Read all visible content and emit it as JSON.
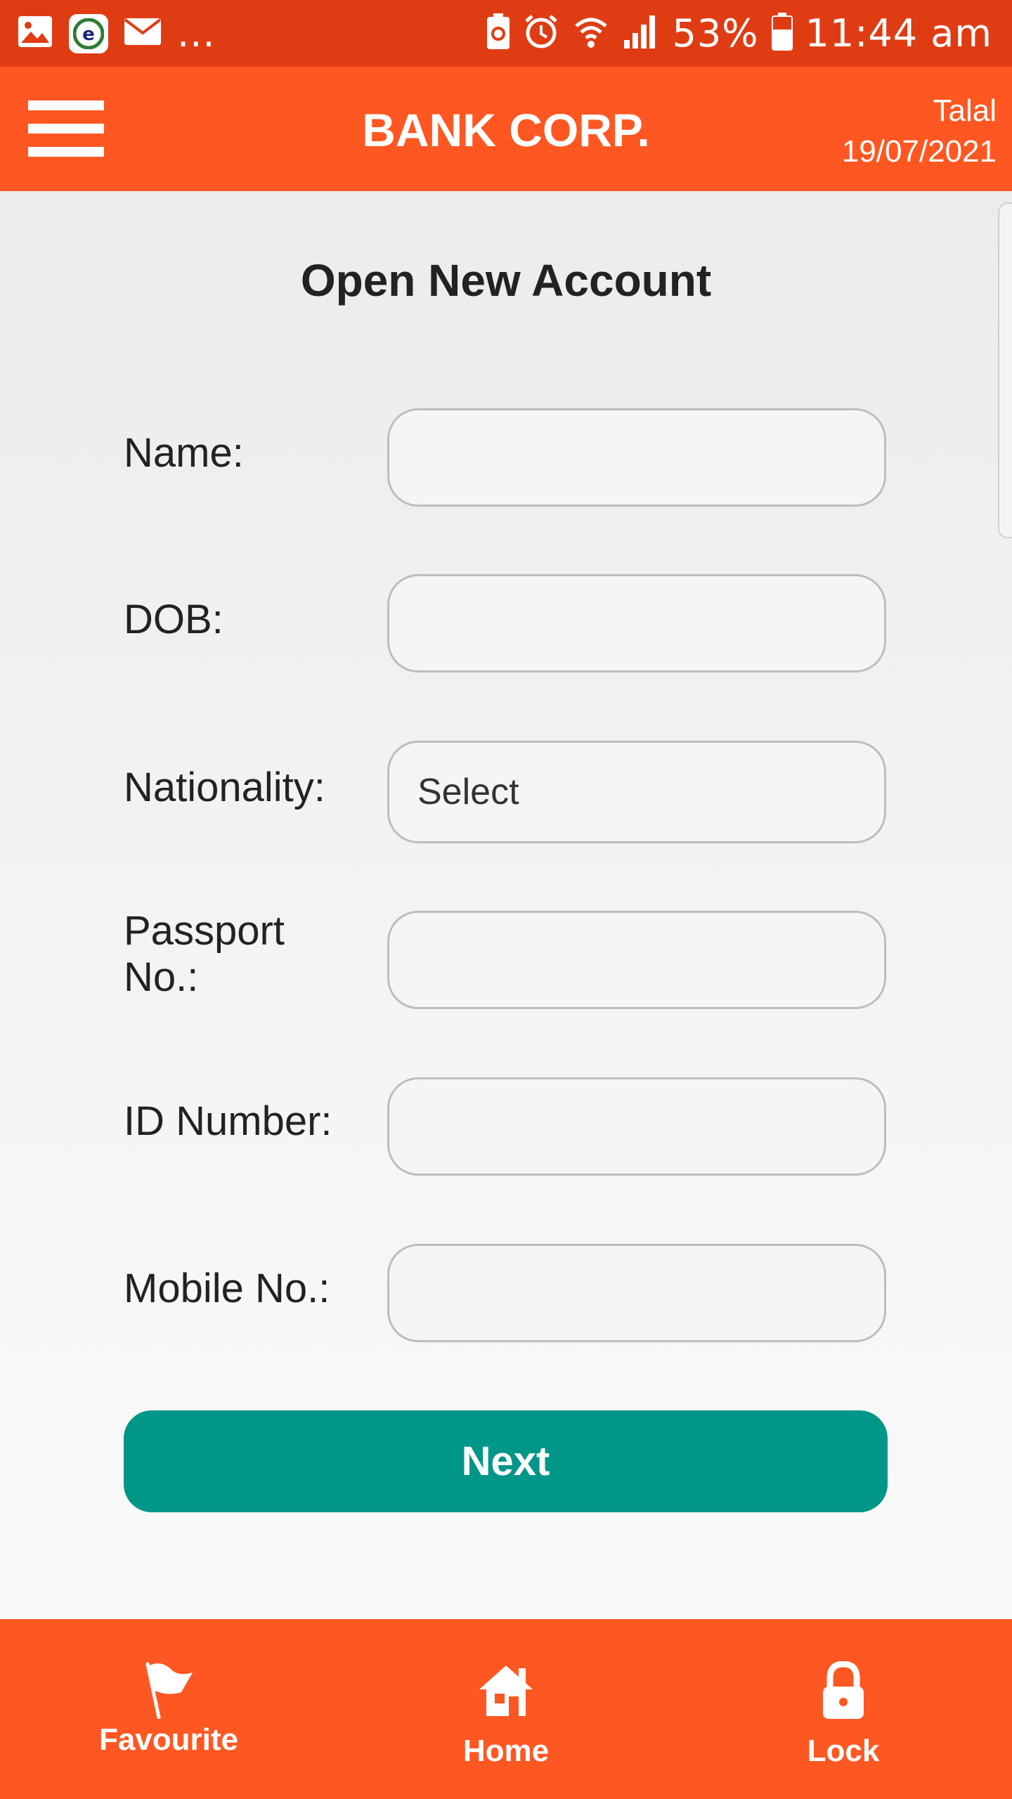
{
  "status_bar": {
    "more": "...",
    "battery": "53%",
    "time": "11:44 am",
    "icons": [
      "gallery-icon",
      "app-e-icon",
      "mail-icon",
      "battery-saver-icon",
      "alarm-icon",
      "wifi-icon",
      "signal-icon",
      "battery-icon"
    ]
  },
  "header": {
    "title": "BANK CORP.",
    "user": "Talal",
    "date": "19/07/2021",
    "menu_icon": "hamburger-menu-icon"
  },
  "form": {
    "title": "Open New Account",
    "fields": [
      {
        "label": "Name:",
        "value": ""
      },
      {
        "label": "DOB:",
        "value": ""
      },
      {
        "label": "Nationality:",
        "value": "Select"
      },
      {
        "label": "Passport No.:",
        "value": ""
      },
      {
        "label": "ID Number:",
        "value": ""
      },
      {
        "label": "Mobile No.:",
        "value": ""
      }
    ],
    "next_label": "Next"
  },
  "bottom_nav": [
    {
      "label": "Favourite",
      "icon": "flag-icon"
    },
    {
      "label": "Home",
      "icon": "home-icon"
    },
    {
      "label": "Lock",
      "icon": "lock-icon"
    }
  ],
  "colors": {
    "status_bar": "#e03c14",
    "app_bar": "#ff5722",
    "primary_button": "#009688",
    "field_border": "#bdbdbd"
  }
}
